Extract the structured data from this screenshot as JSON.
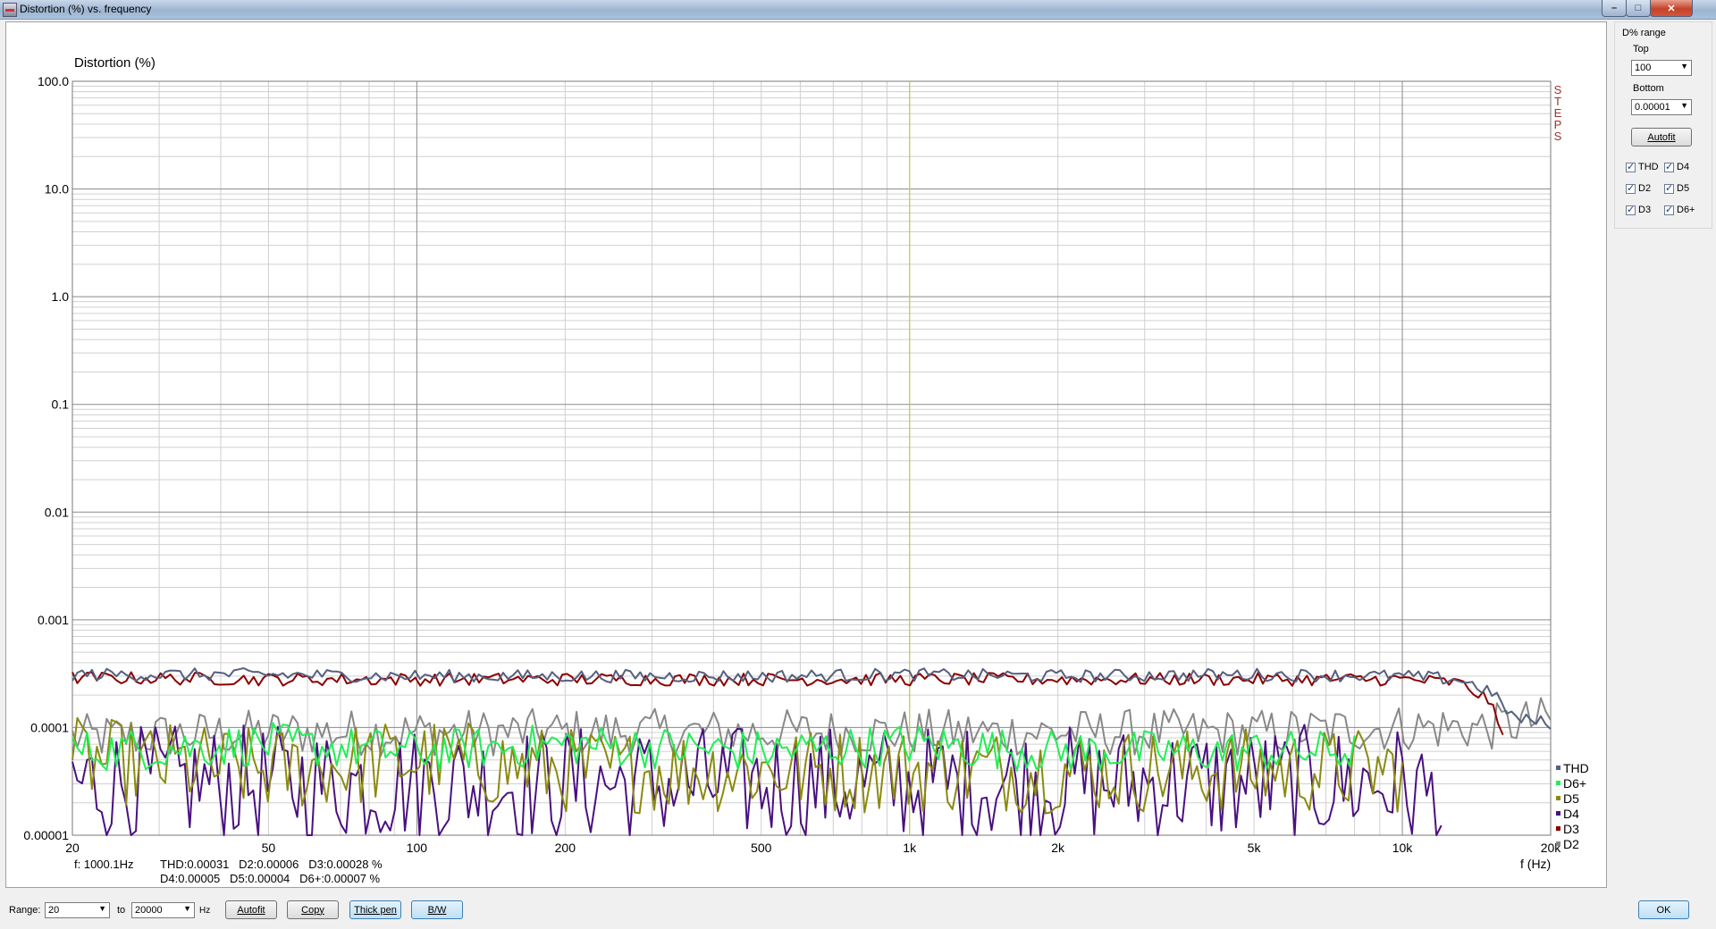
{
  "window": {
    "title": "Distortion (%) vs. frequency"
  },
  "titlebar_buttons": {
    "minimize": "–",
    "maximize": "□",
    "close": "✕"
  },
  "side_panel": {
    "group_label": "D% range",
    "top_label": "Top",
    "top_value": "100",
    "bottom_label": "Bottom",
    "bottom_value": "0.00001",
    "autofit_label": "Autofit",
    "checkboxes": [
      {
        "label": "THD",
        "checked": true
      },
      {
        "label": "D4",
        "checked": true
      },
      {
        "label": "D2",
        "checked": true
      },
      {
        "label": "D5",
        "checked": true
      },
      {
        "label": "D3",
        "checked": true
      },
      {
        "label": "D6+",
        "checked": true
      }
    ]
  },
  "readout": {
    "freq": "f: 1000.1Hz",
    "line1": "THD:0.00031   D2:0.00006   D3:0.00028 %",
    "line2": "D4:0.00005   D5:0.00004   D6+:0.00007 %"
  },
  "bottom_bar": {
    "range_label": "Range:",
    "range_from": "20",
    "to_label": "to",
    "range_to": "20000",
    "hz_label": "Hz",
    "autofit_label": "Autofit",
    "copy_label": "Copy",
    "thickpen_label": "Thick pen",
    "bw_label": "B/W",
    "ok_label": "OK"
  },
  "chart_data": {
    "type": "line",
    "title": "Distortion (%)",
    "xlabel": "f (Hz)",
    "ylabel": "Distortion (%)",
    "x_scale": "log",
    "y_scale": "log",
    "xlim": [
      20,
      20000
    ],
    "ylim": [
      1e-05,
      100
    ],
    "x_ticks": [
      "20",
      "50",
      "100",
      "200",
      "500",
      "1k",
      "2k",
      "5k",
      "10k",
      "20k"
    ],
    "y_ticks": [
      "100.0",
      "10.0",
      "1.0",
      "0.1",
      "0.01",
      "0.001",
      "0.0001",
      "0.00001"
    ],
    "cursor_freq": 1000.1,
    "cursor_color": "#d8d820",
    "steps_label": "STEPS",
    "grid": true,
    "legend_position": "right-bottom",
    "series": [
      {
        "name": "THD",
        "color": "#55607f",
        "x": [
          20,
          50,
          100,
          200,
          500,
          1000,
          2000,
          5000,
          10000,
          13000,
          15000,
          17000,
          20000
        ],
        "y": [
          0.00031,
          0.00031,
          0.0003,
          0.0003,
          0.0003,
          0.00031,
          0.0003,
          0.00031,
          0.0003,
          0.00028,
          0.00022,
          0.00012,
          0.00011
        ]
      },
      {
        "name": "D6+",
        "color": "#22ee55",
        "x": [
          20,
          50,
          100,
          200,
          500,
          1000,
          2000,
          5000,
          8000
        ],
        "y": [
          6e-05,
          7e-05,
          6e-05,
          7e-05,
          6e-05,
          7e-05,
          6e-05,
          6e-05,
          6e-05
        ]
      },
      {
        "name": "D5",
        "color": "#8a8a10",
        "x": [
          20,
          50,
          100,
          200,
          500,
          1000,
          2000,
          5000,
          10000
        ],
        "y": [
          5e-05,
          4e-05,
          5e-05,
          4e-05,
          4e-05,
          4e-05,
          4e-05,
          4e-05,
          4e-05
        ]
      },
      {
        "name": "D4",
        "color": "#4a1080",
        "x": [
          20,
          50,
          100,
          200,
          500,
          1000,
          2000,
          5000,
          10000,
          12000
        ],
        "y": [
          3e-05,
          3e-05,
          3e-05,
          3e-05,
          3e-05,
          3e-05,
          3e-05,
          3e-05,
          3e-05,
          2e-05
        ]
      },
      {
        "name": "D3",
        "color": "#8b0000",
        "x": [
          20,
          50,
          100,
          200,
          500,
          1000,
          2000,
          5000,
          10000,
          13000,
          15000,
          16000
        ],
        "y": [
          0.00029,
          0.00028,
          0.00028,
          0.00028,
          0.00028,
          0.00028,
          0.00028,
          0.00028,
          0.00028,
          0.00026,
          0.00018,
          8e-05
        ]
      },
      {
        "name": "D2",
        "color": "#888888",
        "x": [
          20,
          50,
          100,
          200,
          500,
          1000,
          2000,
          5000,
          10000,
          15000,
          20000
        ],
        "y": [
          8e-05,
          9e-05,
          9e-05,
          9e-05,
          9e-05,
          9e-05,
          9e-05,
          9e-05,
          0.0001,
          0.0001,
          0.00012
        ]
      }
    ]
  }
}
